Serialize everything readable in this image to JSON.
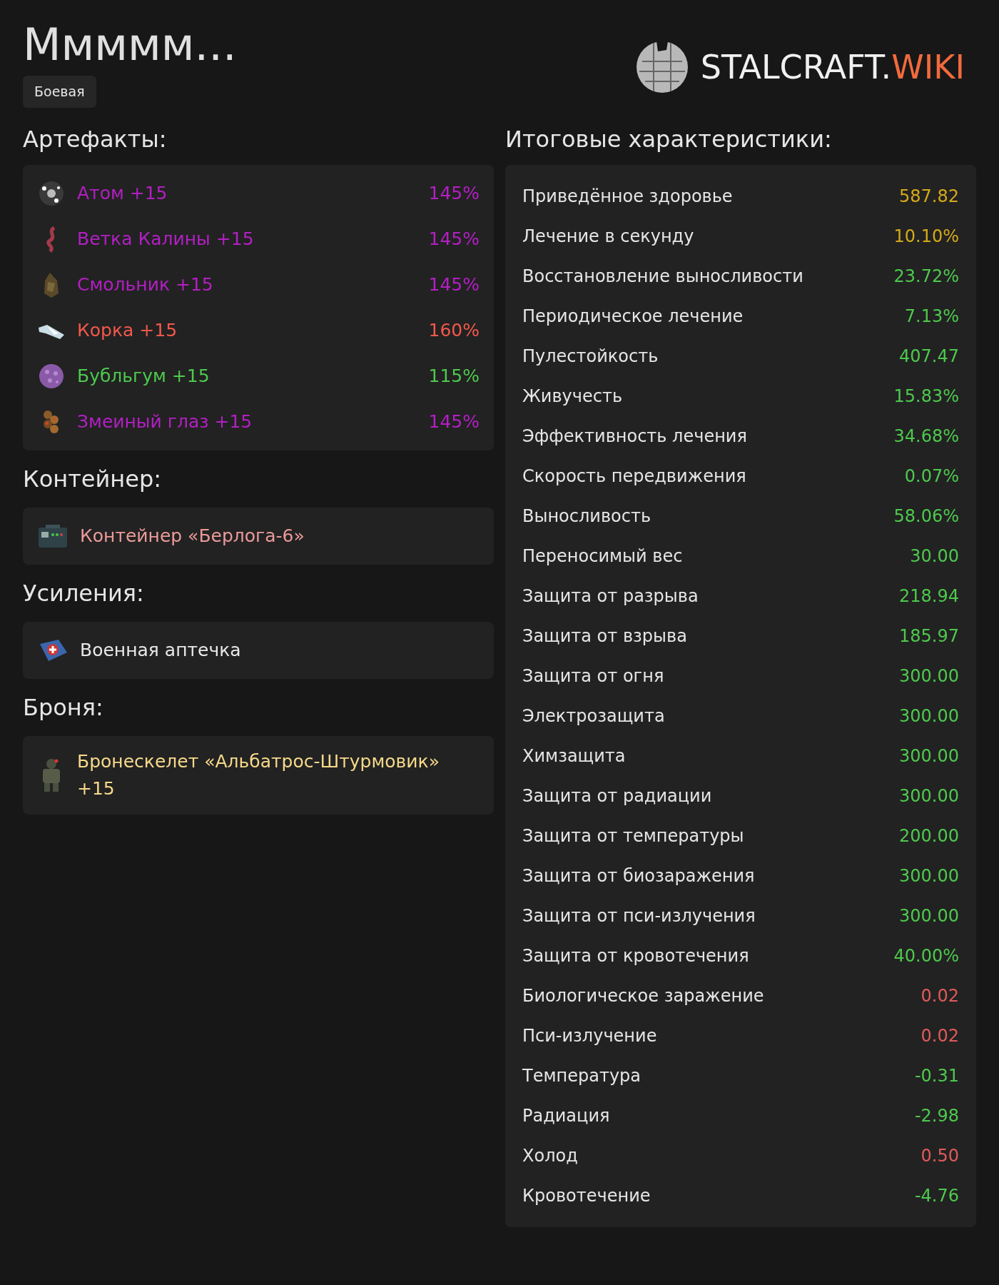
{
  "title": "Ммммм...",
  "tag": "Боевая",
  "logo": {
    "text": "STALCRAFT.",
    "accent": "WIKI"
  },
  "artifacts": {
    "heading": "Артефакты:",
    "items": [
      {
        "name": "Атом +15",
        "value": "145%",
        "color": "#b31fc4"
      },
      {
        "name": "Ветка Калины +15",
        "value": "145%",
        "color": "#b31fc4"
      },
      {
        "name": "Смольник +15",
        "value": "145%",
        "color": "#b31fc4"
      },
      {
        "name": "Корка +15",
        "value": "160%",
        "color": "#f2584b"
      },
      {
        "name": "Бубльгум +15",
        "value": "115%",
        "color": "#4dc94d"
      },
      {
        "name": "Змеиный глаз +15",
        "value": "145%",
        "color": "#b31fc4"
      }
    ]
  },
  "container": {
    "heading": "Контейнер:",
    "name": "Контейнер «Берлога-6»",
    "color": "#ec9a9a"
  },
  "boosts": {
    "heading": "Усиления:",
    "name": "Военная аптечка",
    "color": "#e8e8e8"
  },
  "armor": {
    "heading": "Броня:",
    "name": "Бронескелет «Альбатрос-Штурмовик» +15",
    "color": "#f7d98a"
  },
  "stats": {
    "heading": "Итоговые характеристики:",
    "rows": [
      {
        "label": "Приведённое здоровье",
        "value": "587.82",
        "color": "#d4a91a"
      },
      {
        "label": "Лечение в секунду",
        "value": "10.10%",
        "color": "#d4a91a"
      },
      {
        "label": "Восстановление выносливости",
        "value": "23.72%",
        "color": "#4dc94d"
      },
      {
        "label": "Периодическое лечение",
        "value": "7.13%",
        "color": "#4dc94d"
      },
      {
        "label": "Пулестойкость",
        "value": "407.47",
        "color": "#4dc94d"
      },
      {
        "label": "Живучесть",
        "value": "15.83%",
        "color": "#4dc94d"
      },
      {
        "label": "Эффективность лечения",
        "value": "34.68%",
        "color": "#4dc94d"
      },
      {
        "label": "Скорость передвижения",
        "value": "0.07%",
        "color": "#4dc94d"
      },
      {
        "label": "Выносливость",
        "value": "58.06%",
        "color": "#4dc94d"
      },
      {
        "label": "Переносимый вес",
        "value": "30.00",
        "color": "#4dc94d"
      },
      {
        "label": "Защита от разрыва",
        "value": "218.94",
        "color": "#4dc94d"
      },
      {
        "label": "Защита от взрыва",
        "value": "185.97",
        "color": "#4dc94d"
      },
      {
        "label": "Защита от огня",
        "value": "300.00",
        "color": "#4dc94d"
      },
      {
        "label": "Электрозащита",
        "value": "300.00",
        "color": "#4dc94d"
      },
      {
        "label": "Химзащита",
        "value": "300.00",
        "color": "#4dc94d"
      },
      {
        "label": "Защита от радиации",
        "value": "300.00",
        "color": "#4dc94d"
      },
      {
        "label": "Защита от температуры",
        "value": "200.00",
        "color": "#4dc94d"
      },
      {
        "label": "Защита от биозаражения",
        "value": "300.00",
        "color": "#4dc94d"
      },
      {
        "label": "Защита от пси-излучения",
        "value": "300.00",
        "color": "#4dc94d"
      },
      {
        "label": "Защита от кровотечения",
        "value": "40.00%",
        "color": "#4dc94d"
      },
      {
        "label": "Биологическое заражение",
        "value": "0.02",
        "color": "#e05a5a"
      },
      {
        "label": "Пси-излучение",
        "value": "0.02",
        "color": "#e05a5a"
      },
      {
        "label": "Температура",
        "value": "-0.31",
        "color": "#4dc94d"
      },
      {
        "label": "Радиация",
        "value": "-2.98",
        "color": "#4dc94d"
      },
      {
        "label": "Холод",
        "value": "0.50",
        "color": "#e05a5a"
      },
      {
        "label": "Кровотечение",
        "value": "-4.76",
        "color": "#4dc94d"
      }
    ]
  }
}
